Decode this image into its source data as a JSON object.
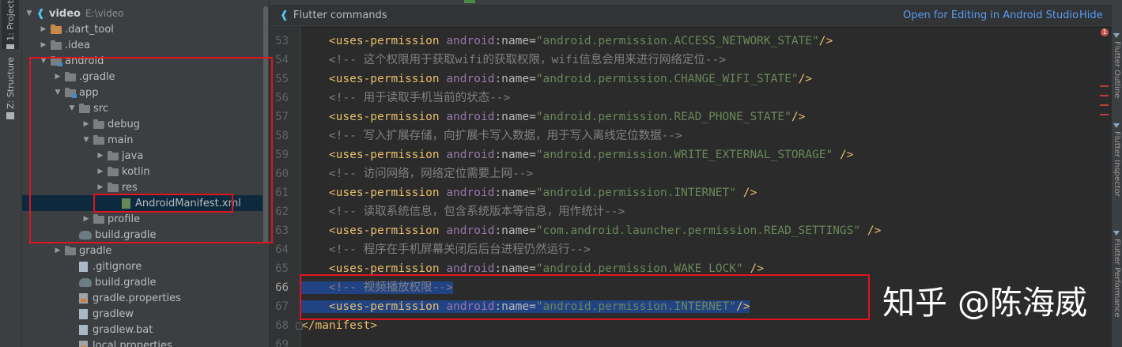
{
  "toolwindows": {
    "project_tab": "1: Project",
    "structure_tab": "Z: Structure"
  },
  "tree": [
    {
      "label": "video",
      "hint": "E:\\video",
      "arrow": "down",
      "icon": "flutter",
      "depth": 0,
      "bold": true
    },
    {
      "label": ".dart_tool",
      "arrow": "right",
      "icon": "folder-orange",
      "depth": 1
    },
    {
      "label": ".idea",
      "arrow": "right",
      "icon": "folder",
      "depth": 1
    },
    {
      "label": "android",
      "arrow": "down",
      "icon": "folder-module",
      "depth": 1
    },
    {
      "label": ".gradle",
      "arrow": "right",
      "icon": "folder",
      "depth": 2
    },
    {
      "label": "app",
      "arrow": "down",
      "icon": "folder-module",
      "depth": 2
    },
    {
      "label": "src",
      "arrow": "down",
      "icon": "folder",
      "depth": 3
    },
    {
      "label": "debug",
      "arrow": "right",
      "icon": "folder",
      "depth": 4
    },
    {
      "label": "main",
      "arrow": "down",
      "icon": "folder",
      "depth": 4
    },
    {
      "label": "java",
      "arrow": "right",
      "icon": "folder",
      "depth": 5
    },
    {
      "label": "kotlin",
      "arrow": "right",
      "icon": "folder",
      "depth": 5
    },
    {
      "label": "res",
      "arrow": "right",
      "icon": "folder",
      "depth": 5
    },
    {
      "label": "AndroidManifest.xml",
      "arrow": "",
      "icon": "xml",
      "depth": 6,
      "selected": true
    },
    {
      "label": "profile",
      "arrow": "right",
      "icon": "folder",
      "depth": 4
    },
    {
      "label": "build.gradle",
      "arrow": "",
      "icon": "gradle",
      "depth": 3
    },
    {
      "label": "gradle",
      "arrow": "right",
      "icon": "folder",
      "depth": 2
    },
    {
      "label": ".gitignore",
      "arrow": "",
      "icon": "file",
      "depth": 3
    },
    {
      "label": "build.gradle",
      "arrow": "",
      "icon": "gradle",
      "depth": 3
    },
    {
      "label": "gradle.properties",
      "arrow": "",
      "icon": "props",
      "depth": 3
    },
    {
      "label": "gradlew",
      "arrow": "",
      "icon": "file",
      "depth": 3
    },
    {
      "label": "gradlew.bat",
      "arrow": "",
      "icon": "file",
      "depth": 3
    },
    {
      "label": "local.properties",
      "arrow": "",
      "icon": "props",
      "depth": 3
    }
  ],
  "banner": {
    "title": "Flutter commands",
    "open_label": "Open for Editing in Android Studio",
    "hide_label": "Hide"
  },
  "editor": {
    "error_count": "1",
    "lines": [
      {
        "num": "53",
        "kind": "perm",
        "name": "android.permission.ACCESS_NETWORK_STATE",
        "close": "/>"
      },
      {
        "num": "54",
        "kind": "comment",
        "text": "<!-- 这个权限用于获取wifi的获取权限，wifi信息会用来进行网络定位-->"
      },
      {
        "num": "55",
        "kind": "perm",
        "name": "android.permission.CHANGE_WIFI_STATE",
        "close": "/>"
      },
      {
        "num": "56",
        "kind": "comment",
        "text": "<!-- 用于读取手机当前的状态-->"
      },
      {
        "num": "57",
        "kind": "perm",
        "name": "android.permission.READ_PHONE_STATE",
        "close": "/>"
      },
      {
        "num": "58",
        "kind": "comment",
        "text": "<!-- 写入扩展存储，向扩展卡写入数据，用于写入离线定位数据-->"
      },
      {
        "num": "59",
        "kind": "perm",
        "name": "android.permission.WRITE_EXTERNAL_STORAGE",
        "close": " />"
      },
      {
        "num": "60",
        "kind": "comment",
        "text": "<!-- 访问网络，网络定位需要上网-->"
      },
      {
        "num": "61",
        "kind": "perm",
        "name": "android.permission.INTERNET",
        "close": " />"
      },
      {
        "num": "62",
        "kind": "comment",
        "text": "<!-- 读取系统信息，包含系统版本等信息，用作统计-->"
      },
      {
        "num": "63",
        "kind": "perm",
        "name": "com.android.launcher.permission.READ_SETTINGS",
        "close": " />"
      },
      {
        "num": "64",
        "kind": "comment",
        "text": "<!-- 程序在手机屏幕关闭后后台进程仍然运行-->"
      },
      {
        "num": "65",
        "kind": "perm",
        "name": "android.permission.WAKE_LOCK",
        "close": " />"
      },
      {
        "num": "66",
        "kind": "comment",
        "text": "<!-- 视频播放权限-->",
        "selected": true
      },
      {
        "num": "67",
        "kind": "perm",
        "name": "android.permission.INTERNET",
        "close": "/>",
        "selected": true
      },
      {
        "num": "68",
        "kind": "close",
        "text": "</manifest>"
      },
      {
        "num": "69",
        "kind": "blank",
        "text": ""
      }
    ],
    "tokens": {
      "open": "<uses-permission ",
      "ns": "android",
      "colon": ":",
      "attr": "name",
      "eq": "="
    }
  },
  "right_panels": [
    "Flutter Outline",
    "Flutter Inspector",
    "Flutter Performance"
  ],
  "watermark": "知乎 @陈海威"
}
